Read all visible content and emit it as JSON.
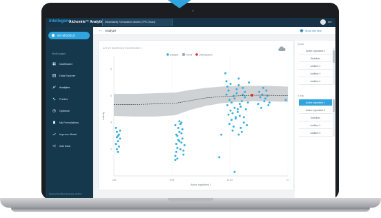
{
  "app": {
    "logo": "intellegens",
    "product": "Alchemite™ Analytics",
    "active_tab": "Dissimilarity Formulation Models (TPE-Gtract)",
    "user": "dev"
  },
  "sidebar": {
    "my_models": "MY MODELS",
    "section": "Model pages",
    "items": [
      {
        "label": "Dashboard",
        "icon": "dashboard-icon"
      },
      {
        "label": "Data Explorer",
        "icon": "table-icon"
      },
      {
        "label": "Analytics",
        "icon": "analytics-icon",
        "active": true
      },
      {
        "label": "Predict",
        "icon": "predict-icon"
      },
      {
        "label": "Optimize",
        "icon": "target-icon"
      },
      {
        "label": "My Formulations",
        "icon": "document-icon"
      },
      {
        "label": "Improve Model",
        "icon": "trend-icon"
      },
      {
        "label": "Add Data",
        "icon": "add-data-icon"
      }
    ],
    "footer": "Powered by Alchemite Engine v8.42.0"
  },
  "page": {
    "back": "←",
    "title": "Analyze",
    "info_link": "Show info here"
  },
  "chart_header": "ACTIVE INGREDIENT INGREDIENT 1",
  "chart_data": {
    "type": "scatter",
    "title": "",
    "xlabel": "Active Ingredient 1",
    "ylabel": "Activity",
    "x_ticks": [
      "1.83",
      "8.65",
      "12.62",
      "17"
    ],
    "y_ticks": [
      "8",
      "6",
      "4",
      "2"
    ],
    "xlim": [
      0,
      17
    ],
    "ylim": [
      0,
      9
    ],
    "legend": [
      "Dataset",
      "Trend",
      "Optimization"
    ],
    "legend_position": "top",
    "series": [
      {
        "name": "Dataset",
        "color": "#39aee0",
        "points": [
          [
            0.2,
            3.6
          ],
          [
            0.3,
            3.3
          ],
          [
            0.3,
            2.9
          ],
          [
            0.4,
            2.6
          ],
          [
            0.4,
            1.8
          ],
          [
            0.5,
            3.1
          ],
          [
            0.6,
            3.4
          ],
          [
            0.2,
            2.4
          ],
          [
            0.5,
            2.2
          ],
          [
            0.3,
            2.0
          ],
          [
            0.4,
            3.0
          ],
          [
            0.6,
            2.8
          ],
          [
            6.0,
            1.2
          ],
          [
            6.0,
            1.5
          ],
          [
            6.1,
            1.8
          ],
          [
            6.2,
            2.1
          ],
          [
            6.1,
            2.4
          ],
          [
            6.3,
            2.7
          ],
          [
            6.2,
            3.0
          ],
          [
            6.4,
            3.3
          ],
          [
            6.3,
            3.6
          ],
          [
            6.5,
            3.9
          ],
          [
            6.4,
            4.1
          ],
          [
            6.6,
            2.5
          ],
          [
            6.5,
            2.0
          ],
          [
            6.7,
            2.8
          ],
          [
            6.6,
            3.2
          ],
          [
            6.8,
            1.6
          ],
          [
            6.7,
            3.5
          ],
          [
            6.9,
            2.3
          ],
          [
            6.8,
            1.9
          ],
          [
            6.0,
            3.8
          ],
          [
            6.2,
            1.3
          ],
          [
            6.4,
            2.6
          ],
          [
            6.6,
            4.0
          ],
          [
            6.1,
            3.1
          ],
          [
            10.9,
            7.7
          ],
          [
            11.0,
            7.1
          ],
          [
            11.1,
            6.7
          ],
          [
            11.2,
            6.4
          ],
          [
            11.0,
            6.1
          ],
          [
            11.3,
            5.7
          ],
          [
            11.1,
            5.3
          ],
          [
            11.4,
            4.9
          ],
          [
            11.2,
            4.6
          ],
          [
            11.5,
            4.2
          ],
          [
            11.3,
            3.9
          ],
          [
            11.6,
            3.4
          ],
          [
            11.4,
            6.9
          ],
          [
            11.7,
            6.0
          ],
          [
            11.5,
            5.5
          ],
          [
            11.8,
            5.1
          ],
          [
            11.6,
            4.7
          ],
          [
            11.9,
            4.4
          ],
          [
            11.7,
            3.7
          ],
          [
            12.0,
            6.5
          ],
          [
            11.8,
            5.8
          ],
          [
            12.1,
            5.0
          ],
          [
            11.9,
            4.3
          ],
          [
            12.2,
            7.3
          ],
          [
            12.0,
            6.2
          ],
          [
            12.3,
            5.4
          ],
          [
            12.1,
            4.8
          ],
          [
            12.4,
            3.6
          ],
          [
            12.2,
            6.8
          ],
          [
            12.5,
            5.6
          ],
          [
            12.3,
            4.5
          ],
          [
            12.6,
            6.1
          ],
          [
            12.4,
            5.2
          ],
          [
            12.7,
            4.0
          ],
          [
            12.5,
            3.3
          ],
          [
            12.8,
            5.9
          ],
          [
            12.6,
            6.6
          ],
          [
            12.9,
            5.0
          ],
          [
            12.7,
            4.4
          ],
          [
            13.0,
            3.8
          ],
          [
            12.8,
            6.3
          ],
          [
            13.1,
            5.5
          ],
          [
            10.5,
            3.1
          ],
          [
            10.3,
            1.4
          ],
          [
            11.8,
            0.3
          ],
          [
            13.2,
            7.0
          ],
          [
            12.2,
            3.1
          ],
          [
            14.1,
            5.4
          ],
          [
            14.3,
            5.9
          ],
          [
            14.5,
            6.1
          ],
          [
            14.7,
            5.6
          ],
          [
            14.9,
            6.4
          ],
          [
            15.1,
            5.3
          ],
          [
            14.2,
            6.3
          ],
          [
            14.4,
            5.1
          ],
          [
            14.6,
            6.6
          ],
          [
            14.8,
            5.8
          ],
          [
            15.0,
            6.0
          ],
          [
            15.2,
            5.5
          ],
          [
            16.8,
            5.7
          ]
        ]
      },
      {
        "name": "Trend",
        "color": "#333333",
        "points": [
          [
            0,
            5.35
          ],
          [
            2,
            5.35
          ],
          [
            4,
            5.4
          ],
          [
            6,
            5.45
          ],
          [
            7.5,
            5.65
          ],
          [
            9,
            5.85
          ],
          [
            10.5,
            5.95
          ],
          [
            12,
            6.0
          ],
          [
            13.5,
            6.05
          ],
          [
            15,
            6.05
          ],
          [
            17,
            6.02
          ]
        ]
      },
      {
        "name": "Optimization",
        "color": "#e02a2a",
        "points": [
          [
            13.5,
            6.05
          ]
        ]
      }
    ],
    "trend_band": {
      "upper": [
        [
          0,
          6.15
        ],
        [
          2,
          6.15
        ],
        [
          4,
          6.2
        ],
        [
          6,
          6.25
        ],
        [
          7.5,
          6.45
        ],
        [
          9,
          6.6
        ],
        [
          10.5,
          6.7
        ],
        [
          12,
          6.75
        ],
        [
          13.5,
          6.75
        ],
        [
          15,
          6.75
        ],
        [
          17,
          6.7
        ]
      ],
      "lower": [
        [
          0,
          4.5
        ],
        [
          2,
          4.45
        ],
        [
          4,
          4.45
        ],
        [
          6,
          4.55
        ],
        [
          7.5,
          4.95
        ],
        [
          9,
          5.25
        ],
        [
          10.5,
          5.45
        ],
        [
          12,
          5.55
        ],
        [
          13.5,
          5.6
        ],
        [
          15,
          5.6
        ],
        [
          17,
          5.55
        ]
      ],
      "color": "#bfc3c6"
    }
  },
  "right_panel": {
    "input_header": "Inputs",
    "inputs": [
      {
        "label": "Active Ingredient 2",
        "selected": false
      },
      {
        "label": "Stabiliser",
        "selected": false
      },
      {
        "label": "Additive 1",
        "selected": false
      },
      {
        "label": "Additive 2",
        "selected": false
      },
      {
        "label": "Additive 4",
        "selected": false
      }
    ],
    "axis_header": "X axis",
    "axis_options": [
      {
        "label": "Active Ingredient 1",
        "selected": true
      },
      {
        "label": "Active Ingredient 2",
        "selected": false
      },
      {
        "label": "Stabiliser",
        "selected": false
      },
      {
        "label": "Additive 1",
        "selected": false
      },
      {
        "label": "Additive 2",
        "selected": false
      }
    ]
  }
}
